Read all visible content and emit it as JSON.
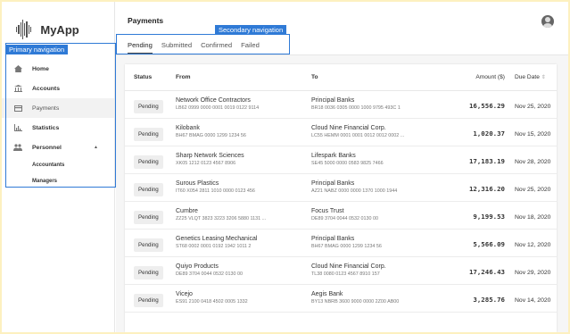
{
  "app": {
    "name": "MyApp"
  },
  "annotations": {
    "primary_nav": "Primary navigation",
    "secondary_nav": "Secondary navigation"
  },
  "sidebar": {
    "items": [
      {
        "label": "Home",
        "icon": "home-icon"
      },
      {
        "label": "Accounts",
        "icon": "bank-icon"
      },
      {
        "label": "Payments",
        "icon": "card-icon",
        "active": true
      },
      {
        "label": "Statistics",
        "icon": "chart-icon"
      },
      {
        "label": "Personnel",
        "icon": "people-icon",
        "expanded": true
      }
    ],
    "sub_items": [
      "Accountants",
      "Managers"
    ]
  },
  "header": {
    "title": "Payments"
  },
  "tabs": [
    {
      "label": "Pending",
      "active": true
    },
    {
      "label": "Submitted"
    },
    {
      "label": "Confirmed"
    },
    {
      "label": "Failed"
    }
  ],
  "table": {
    "columns": {
      "status": "Status",
      "from": "From",
      "to": "To",
      "amount": "Amount ($)",
      "date": "Due Date"
    },
    "rows": [
      {
        "status": "Pending",
        "from": "Network Office Contractors",
        "from_iban": "LB62 0999 0000 0001 0019 0122 9114",
        "to": "Principal Banks",
        "to_iban": "BR18 0036 0305 0000 1000 9795 493C 1",
        "amount": "16,556.29",
        "date": "Nov 25, 2020"
      },
      {
        "status": "Pending",
        "from": "Kilobank",
        "from_iban": "BH67 BMAG 0000 1299 1234 56",
        "to": "Cloud Nine Financial Corp.",
        "to_iban": "LC55 HEMM 0001 0001 0012 0012 0002 ...",
        "amount": "1,020.37",
        "date": "Nov 15, 2020"
      },
      {
        "status": "Pending",
        "from": "Sharp Network Sciences",
        "from_iban": "XK05 1212 0123 4567 8906",
        "to": "Lifespark Banks",
        "to_iban": "SE45 5000 0000 0583 9825 7466",
        "amount": "17,183.19",
        "date": "Nov 28, 2020"
      },
      {
        "status": "Pending",
        "from": "Surous Plastics",
        "from_iban": "IT60 X054 2811 1010 0000 0123 456",
        "to": "Principal Banks",
        "to_iban": "AZ21 NABZ 0000 0000 1370 1000 1944",
        "amount": "12,316.20",
        "date": "Nov 25, 2020"
      },
      {
        "status": "Pending",
        "from": "Cumbre",
        "from_iban": "ZZ25 VLQT 3823 3223 3206 5880 1131 ...",
        "to": "Focus Trust",
        "to_iban": "DE89 3704 0044 0532 0130 00",
        "amount": "9,199.53",
        "date": "Nov 18, 2020"
      },
      {
        "status": "Pending",
        "from": "Genetics Leasing Mechanical",
        "from_iban": "ST68 0002 0001 0192 1942 1011 2",
        "to": "Principal Banks",
        "to_iban": "BH67 BMAG 0000 1299 1234 56",
        "amount": "5,566.09",
        "date": "Nov 12, 2020"
      },
      {
        "status": "Pending",
        "from": "Quiyo Products",
        "from_iban": "DE89 3704 0044 0532 0130 00",
        "to": "Cloud Nine Financial Corp.",
        "to_iban": "TL38 0080 0123 4567 8910 157",
        "amount": "17,246.43",
        "date": "Nov 29, 2020"
      },
      {
        "status": "Pending",
        "from": "Vicejo",
        "from_iban": "ES91 2100 0418 4502 0005 1332",
        "to": "Aegis Bank",
        "to_iban": "BY13 NBRB 3600 9000 0000 2Z00 AB00",
        "amount": "3,285.76",
        "date": "Nov 14, 2020"
      }
    ]
  },
  "colors": {
    "annotation": "#2f7ad6",
    "outer_background": "#fdf0c0"
  }
}
